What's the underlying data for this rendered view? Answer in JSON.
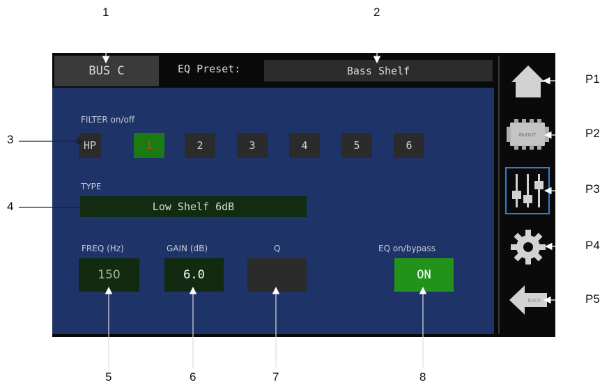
{
  "header": {
    "bus_label": "BUS C",
    "preset_label": "EQ Preset:",
    "preset_value": "Bass Shelf"
  },
  "filter": {
    "label": "FILTER on/off",
    "buttons": [
      "HP",
      "1",
      "2",
      "3",
      "4",
      "5",
      "6"
    ],
    "active": "1"
  },
  "type": {
    "label": "TYPE",
    "value": "Low Shelf 6dB"
  },
  "params": {
    "freq_label": "FREQ (Hz)",
    "freq_value": "150",
    "gain_label": "GAIN (dB)",
    "gain_value": "6.0",
    "q_label": "Q",
    "q_value": "",
    "eq_label": "EQ on/bypass",
    "eq_value": "ON"
  },
  "side_nav": {
    "items": [
      "home-icon",
      "io-module-icon",
      "faders-icon",
      "gear-icon",
      "back-arrow-icon"
    ],
    "selected": "faders-icon",
    "io_icon_text": "IN/OUT",
    "back_icon_text": "BACK"
  },
  "callouts": {
    "numbers": [
      "1",
      "2",
      "3",
      "4",
      "5",
      "6",
      "7",
      "8"
    ],
    "pages": [
      "P1",
      "P2",
      "P3",
      "P4",
      "P5"
    ]
  },
  "colors": {
    "screen_bg": "#1e3368",
    "active_filter": "#1c7a12",
    "eq_on": "#22921a",
    "selected_border": "#2f7fd6"
  }
}
